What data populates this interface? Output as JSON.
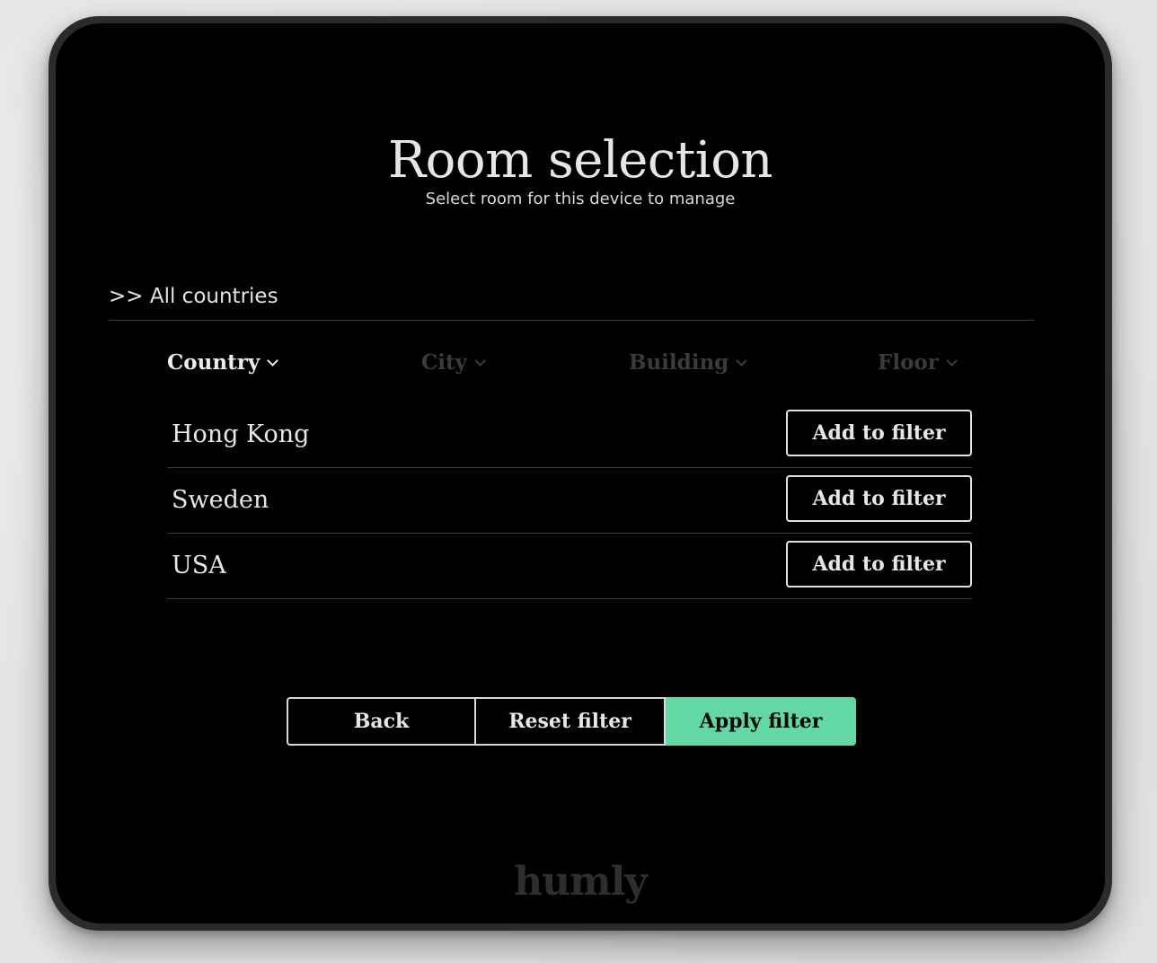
{
  "header": {
    "title": "Room selection",
    "subtitle": "Select room for this device to manage"
  },
  "breadcrumb": {
    "label": ">> All countries"
  },
  "tabs": [
    {
      "label": "Country",
      "active": true,
      "icon": "chevron-down-icon"
    },
    {
      "label": "City",
      "active": false,
      "icon": "chevron-down-icon"
    },
    {
      "label": "Building",
      "active": false,
      "icon": "chevron-down-icon"
    },
    {
      "label": "Floor",
      "active": false,
      "icon": "chevron-down-icon"
    }
  ],
  "list": {
    "items": [
      {
        "name": "Hong Kong",
        "button_label": "Add to filter"
      },
      {
        "name": "Sweden",
        "button_label": "Add to filter"
      },
      {
        "name": "USA",
        "button_label": "Add to filter"
      }
    ]
  },
  "actions": {
    "back_label": "Back",
    "reset_label": "Reset filter",
    "apply_label": "Apply filter"
  },
  "brand": {
    "logo_text": "humly",
    "accent_color": "#62d9a4"
  }
}
